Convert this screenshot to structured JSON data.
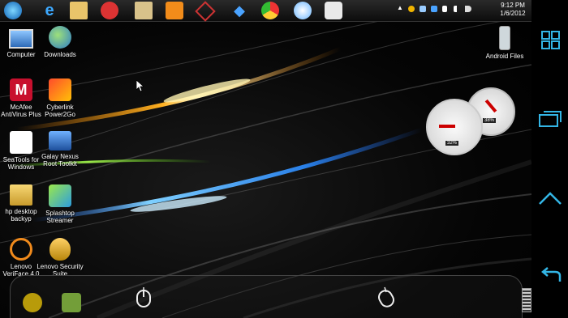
{
  "taskbar": {
    "apps": [
      "start-orb",
      "internet-explorer",
      "file-explorer",
      "ccleaner",
      "folder",
      "media-player",
      "network-tool",
      "dropbox",
      "chrome",
      "safari",
      "paint-tool"
    ],
    "tray_icons": [
      "arrow-up-icon",
      "norton-icon",
      "network-icon",
      "dropbox-icon",
      "flag-icon",
      "signal-icon",
      "volume-icon"
    ],
    "time": "9:12 PM",
    "date": "1/6/2012"
  },
  "desktop": {
    "icons": [
      {
        "label": "Computer",
        "name": "computer"
      },
      {
        "label": "Downloads",
        "name": "downloads"
      },
      {
        "label": "McAfee AntiVirus Plus",
        "name": "mcafee"
      },
      {
        "label": "Cyberlink Power2Go",
        "name": "power2go"
      },
      {
        "label": "SeaTools for Windows",
        "name": "seatools"
      },
      {
        "label": "Galay Nexus Root Toolkit",
        "name": "nexus-toolkit"
      },
      {
        "label": "hp desktop backyp",
        "name": "hp-backup"
      },
      {
        "label": "Splashtop Streamer",
        "name": "splashtop"
      },
      {
        "label": "Lenovo VeriFace 4.0",
        "name": "veriface"
      },
      {
        "label": "Lenovo Security Suite",
        "name": "security-suite"
      },
      {
        "label": "Android Files",
        "name": "android-files"
      }
    ]
  },
  "gadget": {
    "cpu": "32%",
    "memory": "38%"
  },
  "colors": {
    "accent_orange": "#ffa21a",
    "accent_blue": "#2c8cff",
    "accent_green": "#7bd635",
    "nav": "#33b5e5"
  }
}
